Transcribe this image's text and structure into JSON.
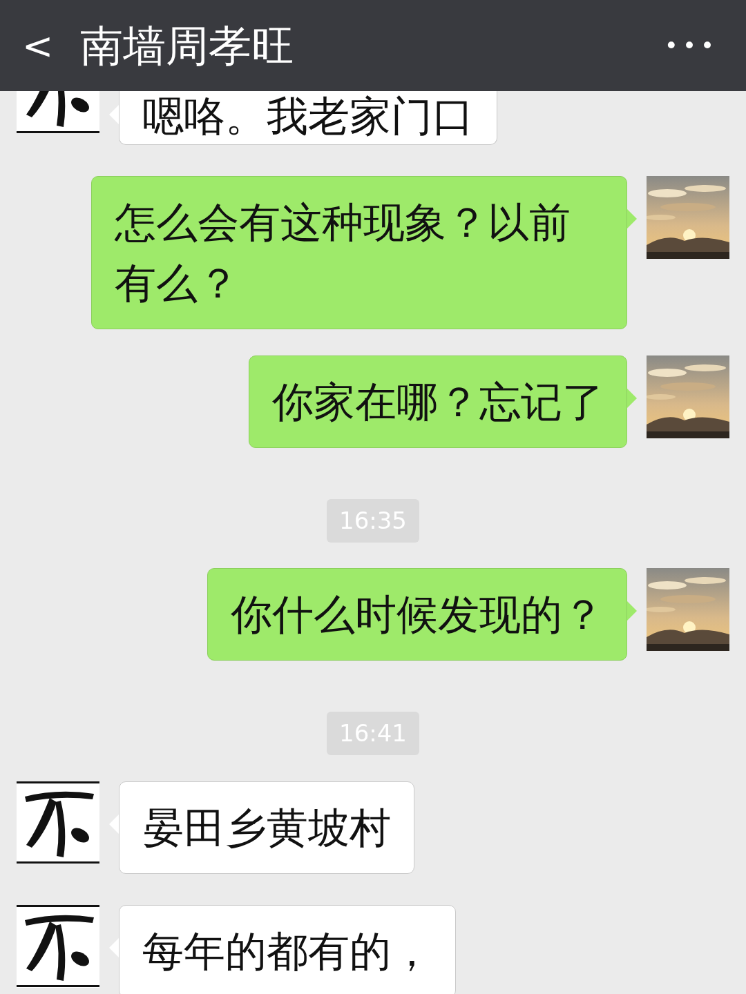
{
  "header": {
    "back": "<",
    "title": "南墙周孝旺",
    "more": "•••"
  },
  "messages": [
    {
      "kind": "received",
      "text": "嗯咯。我老家门口"
    },
    {
      "kind": "sent",
      "text": "怎么会有这种现象？以前有么？"
    },
    {
      "kind": "sent",
      "text": "你家在哪？忘记了"
    },
    {
      "kind": "time",
      "text": "16:35"
    },
    {
      "kind": "sent",
      "text": "你什么时候发现的？"
    },
    {
      "kind": "time",
      "text": "16:41"
    },
    {
      "kind": "received",
      "text": "晏田乡黄坡村"
    },
    {
      "kind": "received",
      "text": "每年的都有的，"
    }
  ]
}
